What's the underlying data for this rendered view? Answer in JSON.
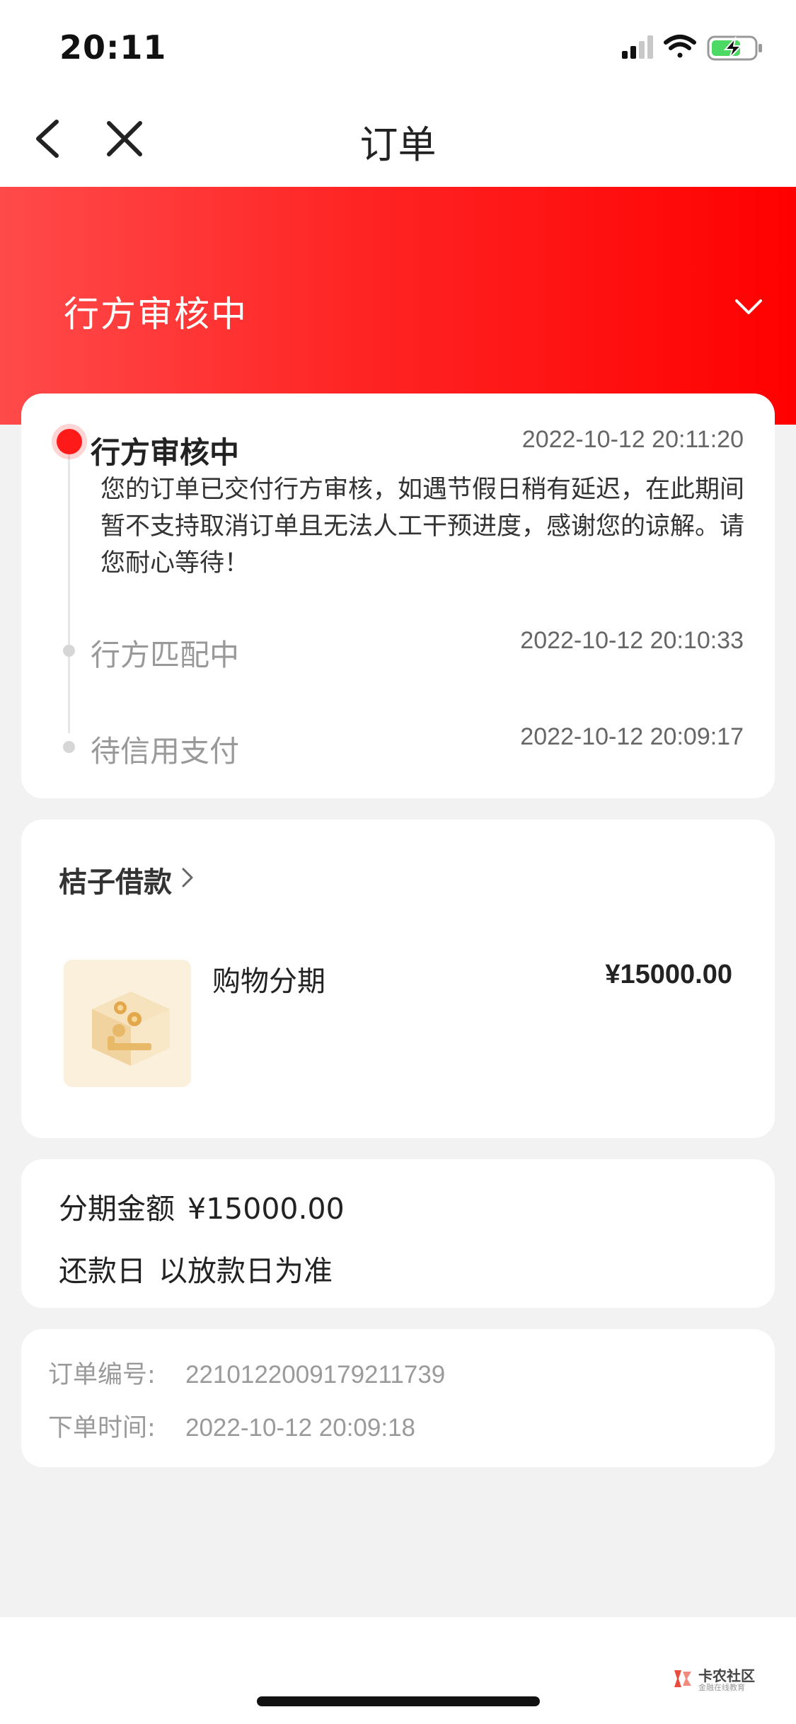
{
  "status_bar": {
    "time": "20:11"
  },
  "nav": {
    "title": "订单"
  },
  "hero": {
    "status": "行方审核中"
  },
  "timeline": [
    {
      "title": "行方审核中",
      "time": "2022-10-12 20:11:20",
      "active": true,
      "description": "您的订单已交付行方审核，如遇节假日稍有延迟，在此期间暂不支持取消订单且无法人工干预进度，感谢您的谅解。请您耐心等待！"
    },
    {
      "title": "行方匹配中",
      "time": "2022-10-12 20:10:33"
    },
    {
      "title": "待信用支付",
      "time": "2022-10-12 20:09:17"
    }
  ],
  "product": {
    "merchant": "桔子借款",
    "name": "购物分期",
    "price": "¥15000.00"
  },
  "amount": {
    "installment_label": "分期金额",
    "installment_value": "¥15000.00",
    "repay_label": "还款日",
    "repay_value": "以放款日为准"
  },
  "order": {
    "number_label": "订单编号:",
    "number_value": "2210122009179211739",
    "time_label": "下单时间:",
    "time_value": "2022-10-12 20:09:18"
  },
  "watermark": {
    "main": "卡农社区",
    "sub": "金融在线教育"
  },
  "icons": {
    "back": "chevron-left-icon",
    "close": "close-icon",
    "hero_toggle": "chevron-down-icon",
    "merchant_link": "chevron-right-icon",
    "signal": "signal-icon",
    "wifi": "wifi-icon",
    "battery": "battery-charging-icon"
  },
  "colors": {
    "accent": "#ff1a1a",
    "battery": "#4cd964"
  }
}
